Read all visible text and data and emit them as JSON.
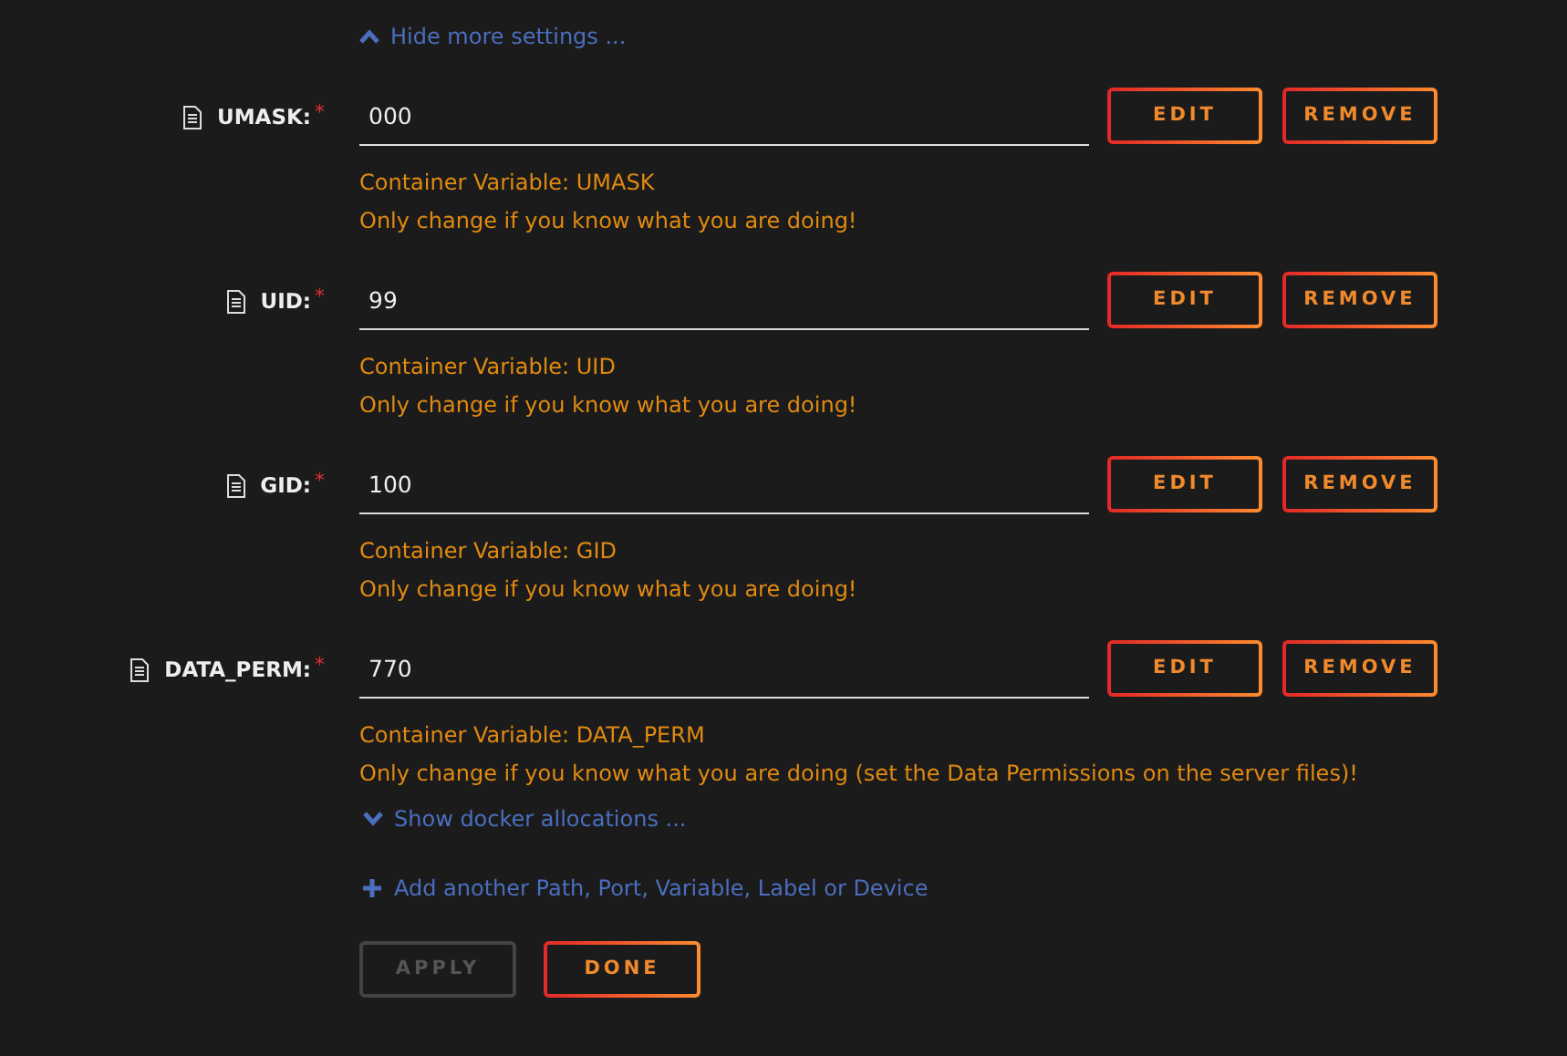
{
  "hide_link": "Hide more settings ...",
  "settings": [
    {
      "label": "UMASK:",
      "required": "*",
      "value": "000",
      "description": "Container Variable: UMASK",
      "warning": "Only change if you know what you are doing!",
      "buttons": [
        "EDIT",
        "REMOVE"
      ]
    },
    {
      "label": "UID:",
      "required": "*",
      "value": "99",
      "description": "Container Variable: UID",
      "warning": "Only change if you know what you are doing!",
      "buttons": [
        "EDIT",
        "REMOVE"
      ]
    },
    {
      "label": "GID:",
      "required": "*",
      "value": "100",
      "description": "Container Variable: GID",
      "warning": "Only change if you know what you are doing!",
      "buttons": [
        "EDIT",
        "REMOVE"
      ]
    },
    {
      "label": "DATA_PERM:",
      "required": "*",
      "value": "770",
      "description": "Container Variable: DATA_PERM",
      "warning": "Only change if you know what you are doing (set the Data Permissions on the server files)!",
      "buttons": [
        "EDIT",
        "REMOVE"
      ]
    }
  ],
  "show_link": "Show docker allocations ...",
  "add_link": "Add another Path, Port, Variable, Label or Device",
  "actions": [
    {
      "label": "APPLY",
      "disabled": true
    },
    {
      "label": "DONE",
      "disabled": false
    }
  ]
}
